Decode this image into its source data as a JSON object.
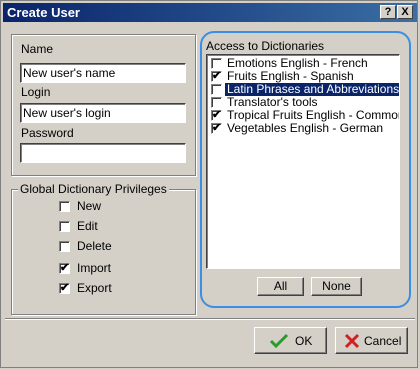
{
  "window": {
    "title": "Create User",
    "help_label": "?",
    "close_label": "X"
  },
  "user_fields": {
    "name_label": "Name",
    "name_value": "New user's name",
    "login_label": "Login",
    "login_value": "New user's login",
    "password_label": "Password",
    "password_value": ""
  },
  "privileges": {
    "title": "Global Dictionary Privileges",
    "items": [
      {
        "label": "New",
        "checked": false
      },
      {
        "label": "Edit",
        "checked": false
      },
      {
        "label": "Delete",
        "checked": false
      },
      {
        "label": "Import",
        "checked": true
      },
      {
        "label": "Export",
        "checked": true
      }
    ]
  },
  "dictionaries": {
    "title": "Access to Dictionaries",
    "items": [
      {
        "label": "Emotions English - French",
        "checked": false,
        "selected": false
      },
      {
        "label": "Fruits English - Spanish",
        "checked": true,
        "selected": false
      },
      {
        "label": "Latin Phrases and Abbreviations",
        "checked": false,
        "selected": true
      },
      {
        "label": "Translator's tools",
        "checked": false,
        "selected": false
      },
      {
        "label": "Tropical Fruits English - Common nar",
        "checked": true,
        "selected": false
      },
      {
        "label": "Vegetables English - German",
        "checked": true,
        "selected": false
      }
    ],
    "all_button": "All",
    "none_button": "None"
  },
  "footer": {
    "ok_label": "OK",
    "cancel_label": "Cancel"
  },
  "colors": {
    "title_bar": "#0a246a",
    "highlight": "#3a8ee6",
    "ok_icon": "#2a9a2a",
    "cancel_icon": "#d02020"
  }
}
